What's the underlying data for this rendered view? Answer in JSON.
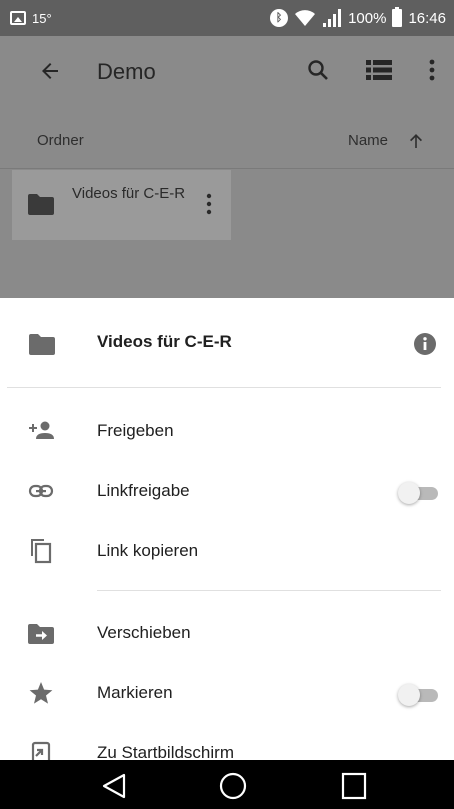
{
  "status_bar": {
    "temperature": "15°",
    "battery_percent": "100%",
    "time": "16:46",
    "icons": [
      "gallery-icon",
      "bluetooth-icon",
      "wifi-icon",
      "signal-icon",
      "battery-icon"
    ]
  },
  "toolbar": {
    "title": "Demo",
    "icons": [
      "back-arrow-icon",
      "search-icon",
      "list-view-icon",
      "more-vert-icon"
    ]
  },
  "sort_bar": {
    "section_label": "Ordner",
    "sort_label": "Name",
    "sort_direction": "ascending"
  },
  "folder_tile": {
    "name": "Videos für C-E-R"
  },
  "sheet": {
    "title": "Videos für C-E-R",
    "items": [
      {
        "label": "Freigeben",
        "icon": "person-add-icon"
      },
      {
        "label": "Linkfreigabe",
        "icon": "link-icon",
        "toggle_on": false
      },
      {
        "label": "Link kopieren",
        "icon": "copy-icon"
      },
      {
        "label": "Verschieben",
        "icon": "folder-move-icon"
      },
      {
        "label": "Markieren",
        "icon": "star-icon",
        "toggle_on": false
      },
      {
        "label": "Zu Startbildschirm",
        "icon": "add-to-home-icon"
      }
    ]
  },
  "colors": {
    "scrim_background": "#8a8a8a",
    "status_bar": "#5f5f5f",
    "sheet_background": "#ffffff",
    "icon_grey": "#6b6b6b",
    "toggle_track": "#b9b9b9",
    "nav_bar": "#000000"
  }
}
